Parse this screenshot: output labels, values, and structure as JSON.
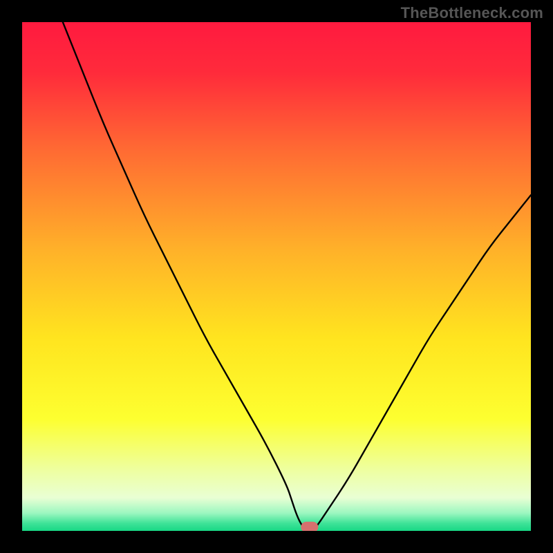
{
  "watermark": "TheBottleneck.com",
  "chart_data": {
    "type": "line",
    "title": "",
    "xlabel": "",
    "ylabel": "",
    "xlim": [
      0,
      100
    ],
    "ylim": [
      0,
      100
    ],
    "grid": false,
    "legend": false,
    "series": [
      {
        "name": "bottleneck-curve",
        "x": [
          8,
          12,
          16,
          20,
          24,
          28,
          32,
          36,
          40,
          44,
          48,
          52,
          53,
          54,
          55,
          56,
          57,
          58,
          60,
          64,
          68,
          72,
          76,
          80,
          84,
          88,
          92,
          96,
          100
        ],
        "y": [
          100,
          90,
          80,
          71,
          62,
          54,
          46,
          38,
          31,
          24,
          17,
          9,
          6,
          3,
          1,
          0,
          0,
          1,
          4,
          10,
          17,
          24,
          31,
          38,
          44,
          50,
          56,
          61,
          66
        ]
      }
    ],
    "marker": {
      "x": 56.5,
      "y": 0.3,
      "color": "#d6706e"
    },
    "gradient_stops": [
      {
        "offset": 0.0,
        "color": "#ff1a3f"
      },
      {
        "offset": 0.1,
        "color": "#ff2b3b"
      },
      {
        "offset": 0.25,
        "color": "#ff6a33"
      },
      {
        "offset": 0.45,
        "color": "#ffb229"
      },
      {
        "offset": 0.62,
        "color": "#ffe41f"
      },
      {
        "offset": 0.78,
        "color": "#fdff30"
      },
      {
        "offset": 0.88,
        "color": "#eeffa0"
      },
      {
        "offset": 0.935,
        "color": "#e9ffd4"
      },
      {
        "offset": 0.965,
        "color": "#9cf7c0"
      },
      {
        "offset": 0.985,
        "color": "#3fe398"
      },
      {
        "offset": 1.0,
        "color": "#18d885"
      }
    ]
  }
}
